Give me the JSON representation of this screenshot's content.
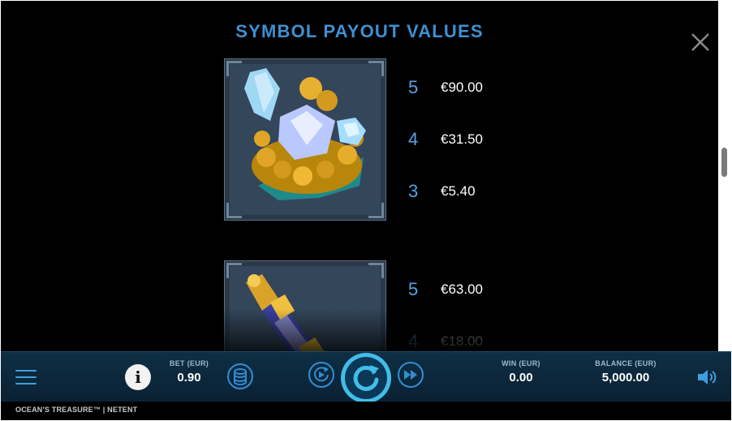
{
  "panel": {
    "title": "SYMBOL PAYOUT VALUES",
    "close_icon": "close-icon"
  },
  "symbols": [
    {
      "name": "crystal-gold-treasure",
      "payouts": [
        {
          "count": "5",
          "value": "€90.00"
        },
        {
          "count": "4",
          "value": "€31.50"
        },
        {
          "count": "3",
          "value": "€5.40"
        }
      ]
    },
    {
      "name": "golden-telescope",
      "payouts": [
        {
          "count": "5",
          "value": "€63.00"
        },
        {
          "count": "4",
          "value": "€18.00"
        }
      ]
    }
  ],
  "bottom_bar": {
    "menu_icon": "hamburger-menu-icon",
    "info_label": "i",
    "bet_label": "BET (EUR)",
    "bet_value": "0.90",
    "coin_icon": "coin-stack-icon",
    "autoplay_icon": "autoplay-icon",
    "spin_icon": "spin-icon",
    "turbo_icon": "fast-forward-icon",
    "win_label": "WIN (EUR)",
    "win_value": "0.00",
    "balance_label": "BALANCE (EUR)",
    "balance_value": "5,000.00",
    "sound_icon": "speaker-icon"
  },
  "footer": {
    "game_name": "OCEAN'S TREASURE™ | NETENT"
  },
  "colors": {
    "title_blue": "#3f8fd0",
    "count_blue": "#5aa3e3",
    "spin_cyan": "#41bde8",
    "bar_bg": "#0f2e44"
  }
}
